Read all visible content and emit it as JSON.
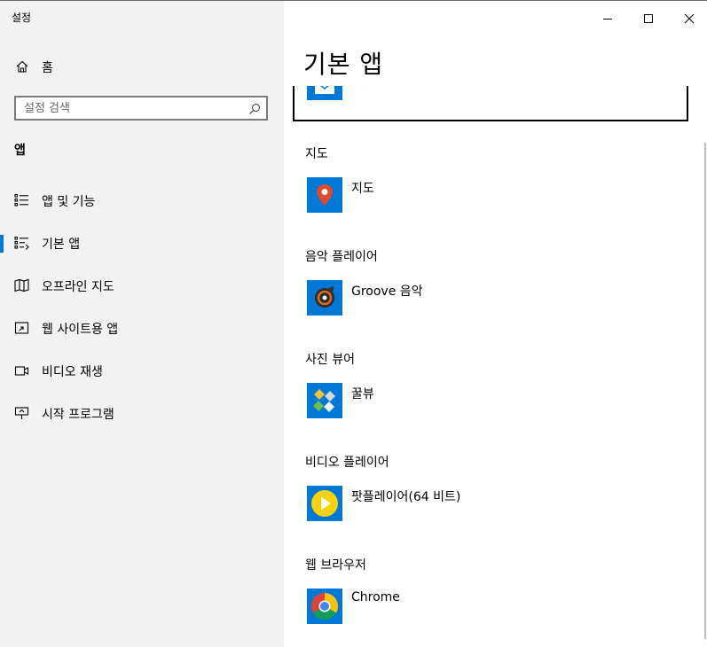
{
  "window": {
    "title": "설정"
  },
  "sidebar": {
    "home_label": "홈",
    "search_placeholder": "설정 검색",
    "section": "앱",
    "items": [
      {
        "label": "앱 및 기능",
        "icon": "apps-features-icon"
      },
      {
        "label": "기본 앱",
        "icon": "default-apps-icon",
        "selected": true
      },
      {
        "label": "오프라인 지도",
        "icon": "offline-maps-icon"
      },
      {
        "label": "웹 사이트용 앱",
        "icon": "apps-for-websites-icon"
      },
      {
        "label": "비디오 재생",
        "icon": "video-playback-icon"
      },
      {
        "label": "시작 프로그램",
        "icon": "startup-icon"
      }
    ]
  },
  "main": {
    "title": "기본 앱",
    "previous_app_partial": "메일",
    "categories": [
      {
        "heading": "지도",
        "app": "지도",
        "icon": "maps-icon"
      },
      {
        "heading": "음악 플레이어",
        "app": "Groove 음악",
        "icon": "groove-music-icon"
      },
      {
        "heading": "사진 뷰어",
        "app": "꿀뷰",
        "icon": "honeyview-icon"
      },
      {
        "heading": "비디오 플레이어",
        "app": "팟플레이어(64 비트)",
        "icon": "potplayer-icon"
      },
      {
        "heading": "웹 브라우저",
        "app": "Chrome",
        "icon": "chrome-icon"
      }
    ]
  },
  "colors": {
    "accent": "#0078d7",
    "sidebar_bg": "#f2f2f2",
    "potplayer_yellow": "#f5d200"
  }
}
